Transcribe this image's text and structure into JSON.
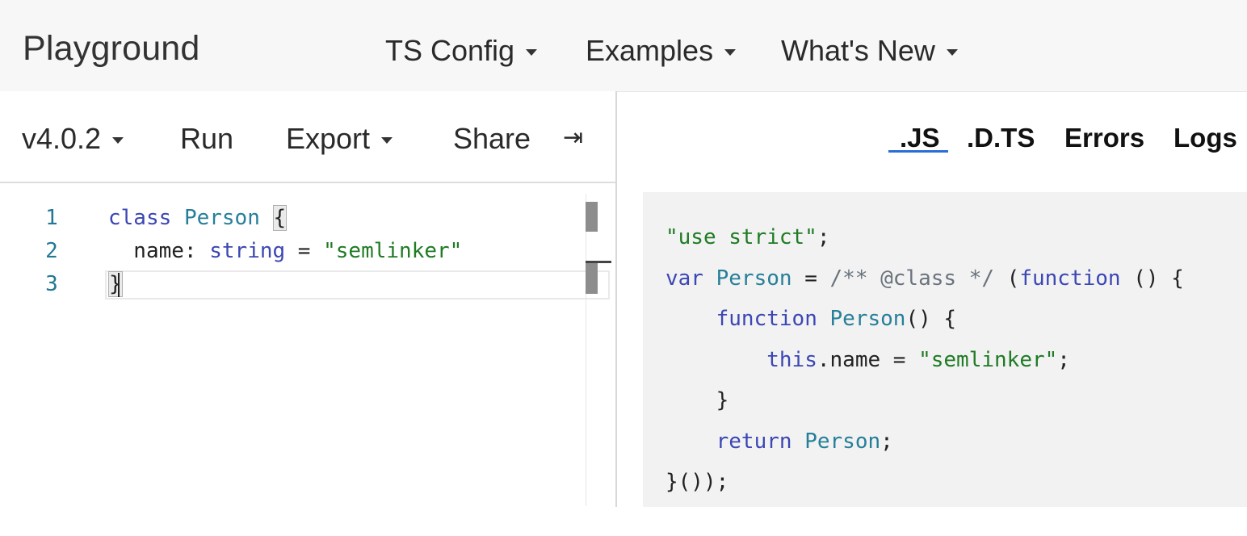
{
  "header": {
    "brand": "Playground",
    "menus": [
      {
        "label": "TS Config"
      },
      {
        "label": "Examples"
      },
      {
        "label": "What's New"
      }
    ]
  },
  "toolbar": {
    "version": "v4.0.2",
    "run": "Run",
    "export": "Export",
    "share": "Share",
    "collapse_glyph": "⇥"
  },
  "output_tabs": [
    {
      "label": ".JS",
      "active": true
    },
    {
      "label": ".D.TS"
    },
    {
      "label": "Errors"
    },
    {
      "label": "Logs"
    }
  ],
  "editor": {
    "line_numbers": [
      "1",
      "2",
      "3"
    ],
    "lines": [
      [
        {
          "t": "class",
          "c": "kw"
        },
        {
          "t": " ",
          "c": "plain"
        },
        {
          "t": "Person",
          "c": "cls"
        },
        {
          "t": " ",
          "c": "plain"
        },
        {
          "t": "{",
          "c": "bracket"
        }
      ],
      [
        {
          "t": "  name: ",
          "c": "plain"
        },
        {
          "t": "string",
          "c": "kw"
        },
        {
          "t": " = ",
          "c": "plain"
        },
        {
          "t": "\"semlinker\"",
          "c": "str"
        }
      ],
      [
        {
          "t": "}",
          "c": "bracket"
        }
      ]
    ]
  },
  "output": {
    "lines": [
      [
        {
          "t": "\"use strict\"",
          "c": "str"
        },
        {
          "t": ";",
          "c": "plain"
        }
      ],
      [
        {
          "t": "var",
          "c": "kw"
        },
        {
          "t": " ",
          "c": "plain"
        },
        {
          "t": "Person",
          "c": "cls"
        },
        {
          "t": " = ",
          "c": "plain"
        },
        {
          "t": "/** @class */",
          "c": "cm"
        },
        {
          "t": " (",
          "c": "plain"
        },
        {
          "t": "function",
          "c": "kw"
        },
        {
          "t": " () {",
          "c": "plain"
        }
      ],
      [
        {
          "t": "    ",
          "c": "plain"
        },
        {
          "t": "function",
          "c": "kw"
        },
        {
          "t": " ",
          "c": "plain"
        },
        {
          "t": "Person",
          "c": "cls"
        },
        {
          "t": "() {",
          "c": "plain"
        }
      ],
      [
        {
          "t": "        ",
          "c": "plain"
        },
        {
          "t": "this",
          "c": "kw"
        },
        {
          "t": ".name = ",
          "c": "plain"
        },
        {
          "t": "\"semlinker\"",
          "c": "str"
        },
        {
          "t": ";",
          "c": "plain"
        }
      ],
      [
        {
          "t": "    }",
          "c": "plain"
        }
      ],
      [
        {
          "t": "    ",
          "c": "plain"
        },
        {
          "t": "return",
          "c": "kw"
        },
        {
          "t": " ",
          "c": "plain"
        },
        {
          "t": "Person",
          "c": "cls"
        },
        {
          "t": ";",
          "c": "plain"
        }
      ],
      [
        {
          "t": "}());",
          "c": "plain"
        }
      ]
    ]
  },
  "colors": {
    "keyword": "#3b47b4",
    "type": "#267f99",
    "string": "#1f7b24",
    "comment": "#6a737d",
    "tab_underline": "#2b6dd6"
  }
}
